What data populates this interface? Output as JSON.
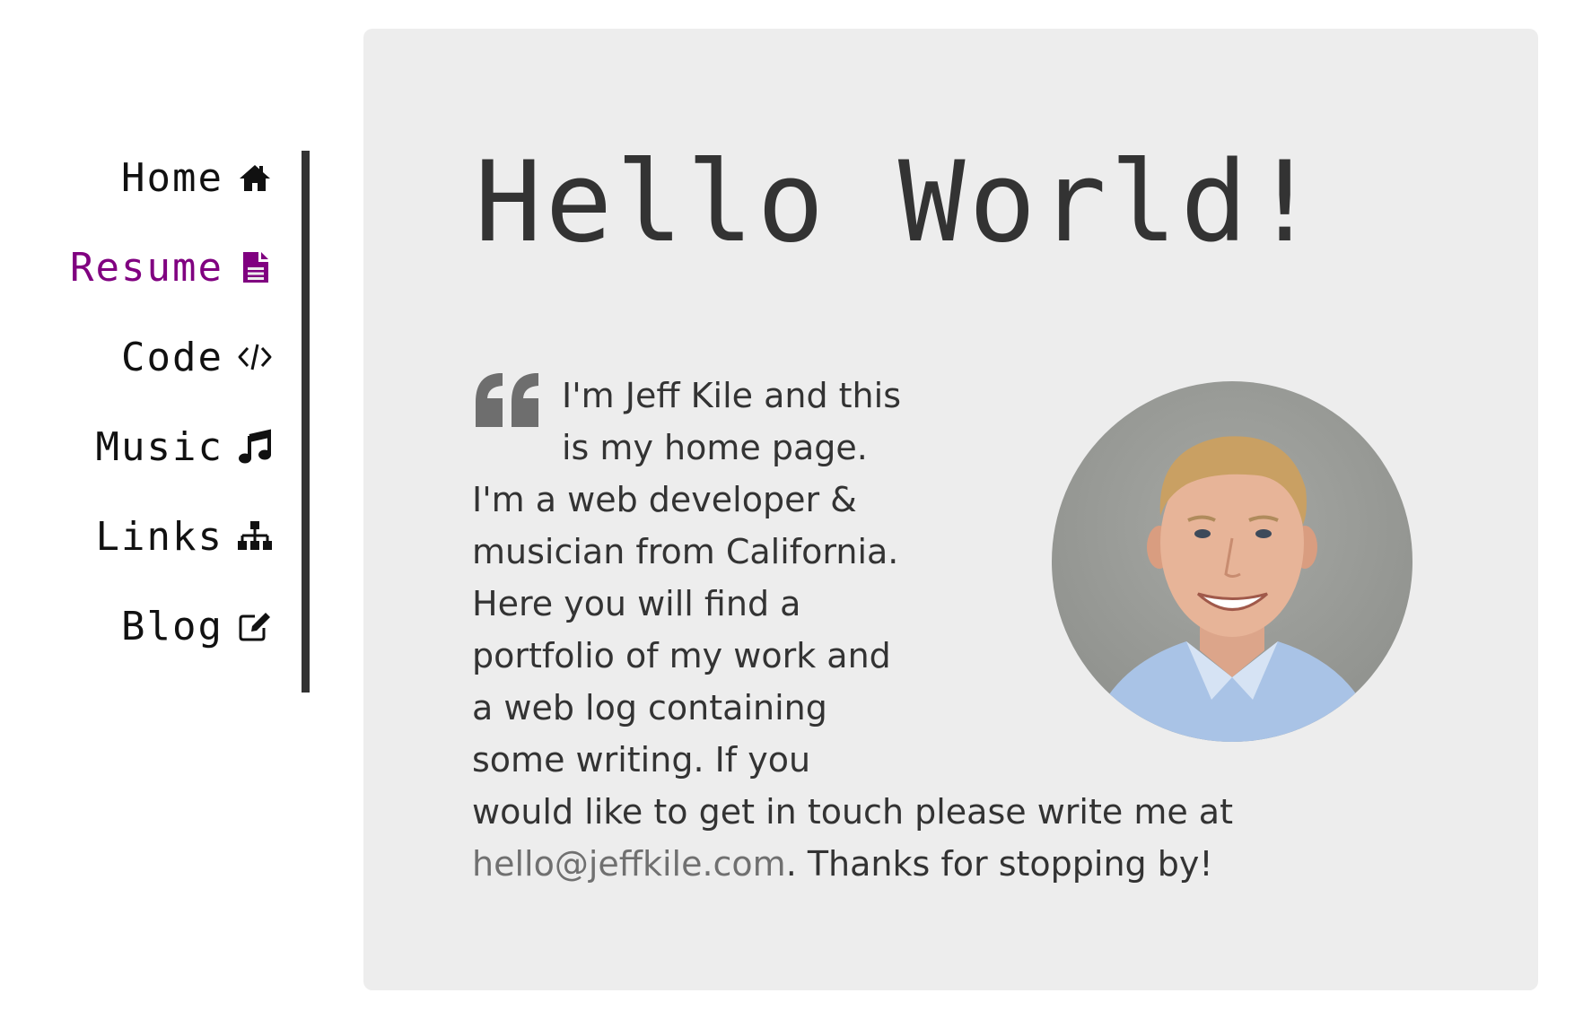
{
  "nav": {
    "items": [
      {
        "label": "Home",
        "icon": "home-icon",
        "active": false
      },
      {
        "label": "Resume",
        "icon": "file-icon",
        "active": true
      },
      {
        "label": "Code",
        "icon": "code-icon",
        "active": false
      },
      {
        "label": "Music",
        "icon": "music-icon",
        "active": false
      },
      {
        "label": "Links",
        "icon": "sitemap-icon",
        "active": false
      },
      {
        "label": "Blog",
        "icon": "edit-icon",
        "active": false
      }
    ],
    "active_color": "#800080"
  },
  "main": {
    "title": "Hello World!",
    "intro_before": "I'm Jeff Kile and this is my home page. I'm a web developer & musician from California. Here you will find a portfolio of my work and a web log containing some writing. If you would like to get in touch please write me at ",
    "email": "hello@jeffkile.com",
    "intro_after": ". Thanks for stopping by!",
    "quote_icon": "quote-left-icon",
    "avatar": "profile-photo"
  }
}
